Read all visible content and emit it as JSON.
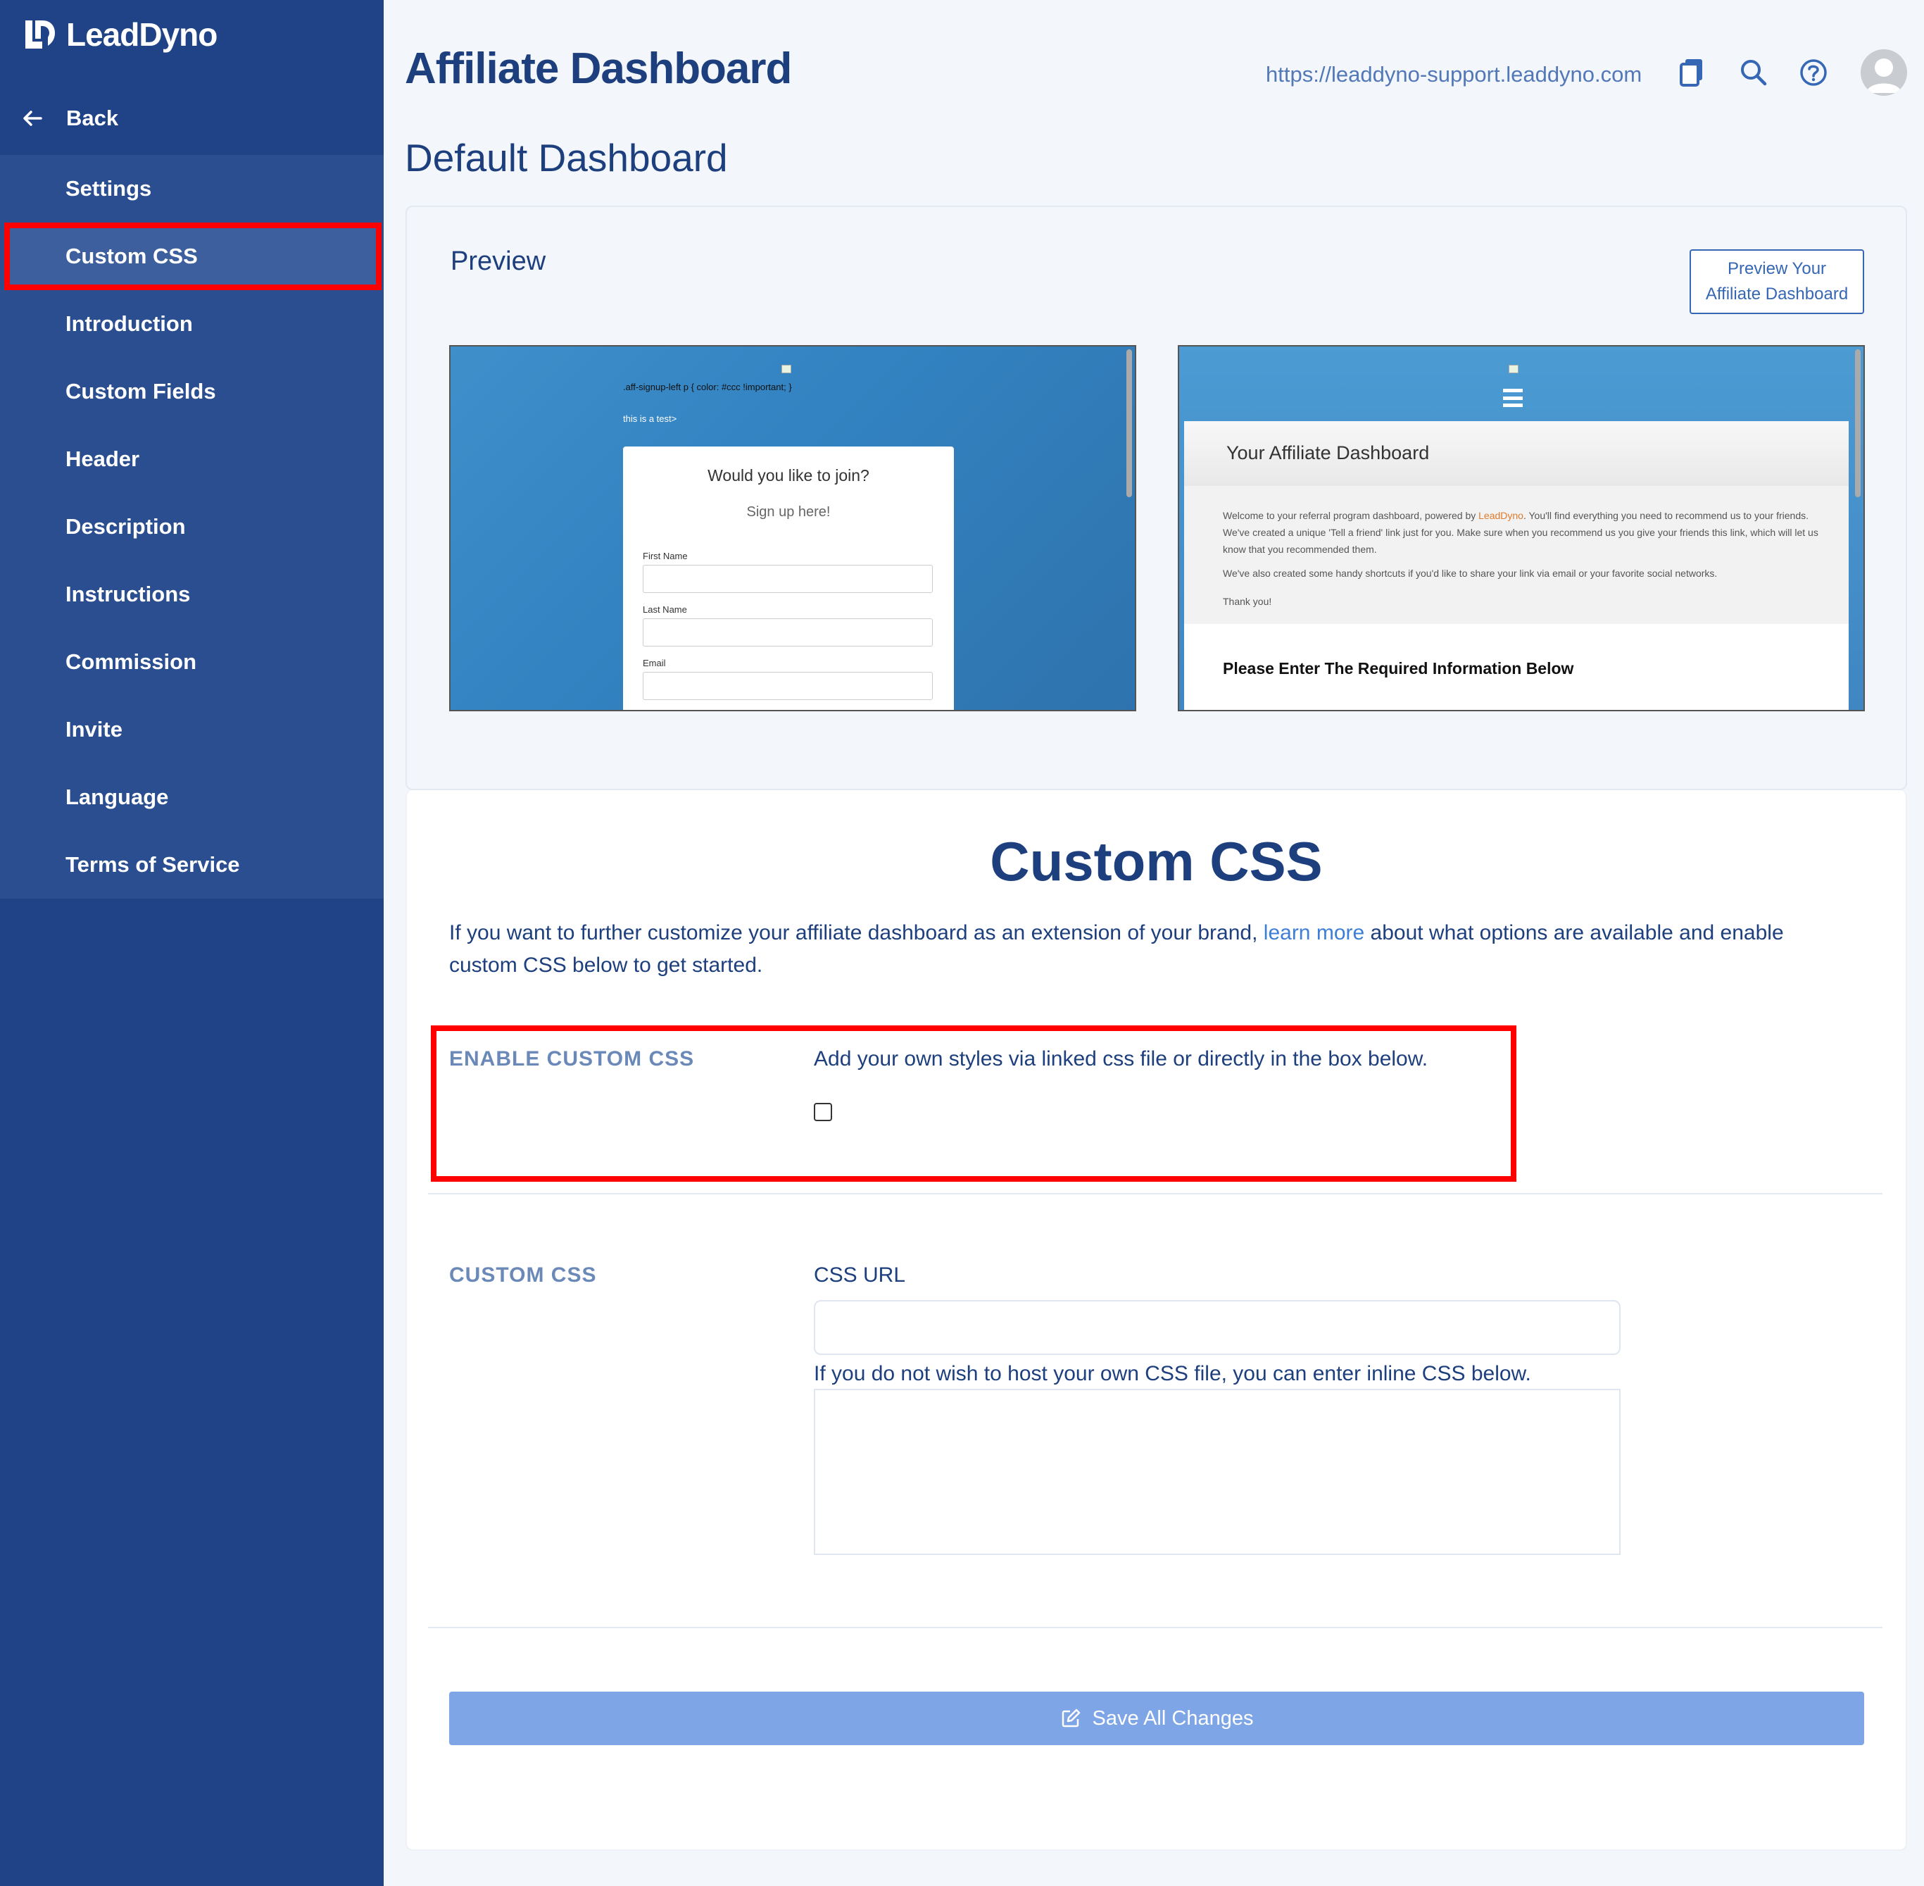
{
  "app": {
    "name": "LeadDyno"
  },
  "sidebar": {
    "back_label": "Back",
    "items": [
      {
        "label": "Settings"
      },
      {
        "label": "Custom CSS",
        "active": true
      },
      {
        "label": "Introduction"
      },
      {
        "label": "Custom Fields"
      },
      {
        "label": "Header"
      },
      {
        "label": "Description"
      },
      {
        "label": "Instructions"
      },
      {
        "label": "Commission"
      },
      {
        "label": "Invite"
      },
      {
        "label": "Language"
      },
      {
        "label": "Terms of Service"
      }
    ]
  },
  "header": {
    "title": "Affiliate Dashboard",
    "url": "https://leaddyno-support.leaddyno.com",
    "icons": [
      "copy-icon",
      "search-icon",
      "help-icon",
      "avatar"
    ]
  },
  "dashboard_title": "Default Dashboard",
  "preview": {
    "label": "Preview",
    "button_line1": "Preview Your",
    "button_line2": "Affiliate Dashboard",
    "signup": {
      "css_text": ".aff-signup-left p { color: #ccc !important; }",
      "test_text": "this is a test>",
      "join": "Would you like to join?",
      "signup": "Sign up here!",
      "first_name": "First Name",
      "last_name": "Last Name",
      "email": "Email"
    },
    "dashboard": {
      "title": "Your Affiliate Dashboard",
      "welcome_pre": "Welcome to your referral program dashboard, powered by ",
      "welcome_link": "LeadDyno",
      "welcome_post": ". You'll find everything you need to recommend us to your friends. We've created a unique 'Tell a friend' link just for you. Make sure when you recommend us you give your friends this link, which will let us know that you recommended them.",
      "shortcuts": "We've also created some handy shortcuts if you'd like to share your link via email or your favorite social networks.",
      "thanks": "Thank you!",
      "required": "Please Enter The Required Information Below"
    }
  },
  "custom_css": {
    "heading": "Custom CSS",
    "desc_pre": "If you want to further customize your affiliate dashboard as an extension of your brand, ",
    "desc_link": "learn more",
    "desc_post": " about what options are available and enable custom CSS below to get started.",
    "enable_label": "ENABLE CUSTOM CSS",
    "enable_text": "Add your own styles via linked css file or directly in the box below.",
    "enable_checked": false,
    "section_label": "CUSTOM CSS",
    "url_label": "CSS URL",
    "url_value": "",
    "inline_hint": "If you do not wish to host your own CSS file, you can enter inline CSS below.",
    "inline_value": "",
    "save_label": "Save All Changes"
  },
  "colors": {
    "sidebar": "#1f4386",
    "accent": "#3567b5",
    "highlight": "#ff0000",
    "save_button": "#7ea5e6"
  }
}
